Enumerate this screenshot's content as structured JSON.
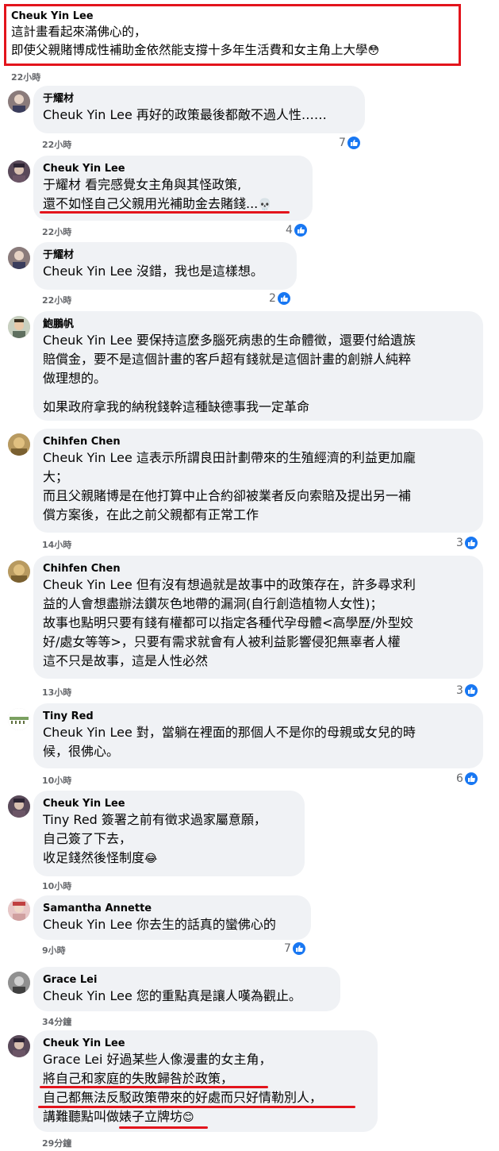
{
  "colors": {
    "highlight_red": "#e3141c",
    "like_blue": "#1877f2",
    "bubble_bg": "#f0f2f5",
    "meta_gray": "#65676b"
  },
  "comments": [
    {
      "author": "Cheuk Yin Lee",
      "lines": [
        "這計畫看起來滿佛心的，",
        "即使父親賭博成性補助金依然能支撐十多年生活費和女主角上大學"
      ],
      "emoji": "😳",
      "time": "22小時"
    },
    {
      "author": "于耀材",
      "mention": "Cheuk Yin Lee",
      "lines": [
        " 再好的政策最後都敵不過人性……"
      ],
      "time": "22小時",
      "likes": "7"
    },
    {
      "author": "Cheuk Yin Lee",
      "mention": "于耀材",
      "lines": [
        " 看完感覺女主角與其怪政策,",
        "還不如怪自己父親用光補助金去賭錢..."
      ],
      "emoji": "💀",
      "time": "22小時",
      "likes": "4"
    },
    {
      "author": "于耀材",
      "mention": "Cheuk Yin Lee",
      "lines": [
        " 沒錯，我也是這樣想。"
      ],
      "time": "22小時",
      "likes": "2"
    },
    {
      "author": "鮑鵬帆",
      "mention": "Cheuk Yin Lee",
      "lines": [
        " 要保持這麼多腦死病患的生命體徵，還要付給遺族",
        "賠償金，要不是這個計畫的客戶超有錢就是這個計畫的創辦人純粹",
        "做理想的。"
      ],
      "paragraph2": "如果政府拿我的納稅錢幹這種缺德事我一定革命"
    },
    {
      "author": "Chihfen Chen",
      "mention": "Cheuk Yin Lee",
      "lines": [
        " 這表示所謂良田計劃帶來的生殖經濟的利益更加龐",
        "大；",
        "而且父親賭博是在他打算中止合約卻被業者反向索賠及提出另一補",
        "償方案後，在此之前父親都有正常工作"
      ],
      "time": "14小時",
      "likes": "3"
    },
    {
      "author": "Chihfen Chen",
      "mention": "Cheuk Yin Lee",
      "lines": [
        " 但有沒有想過就是故事中的政策存在，許多尋求利",
        "益的人會想盡辦法鑽灰色地帶的漏洞(自行創造植物人女性)；",
        "故事也點明只要有錢有權都可以指定各種代孕母體<高學歷/外型姣",
        "好/處女等等>，只要有需求就會有人被利益影響侵犯無辜者人權",
        "這不只是故事，這是人性必然"
      ],
      "time": "13小時",
      "likes": "3"
    },
    {
      "author": "Tiny Red",
      "mention": "Cheuk Yin Lee",
      "lines": [
        " 對，當躺在裡面的那個人不是你的母親或女兒的時",
        "候，很佛心。"
      ],
      "time": "10小時",
      "likes": "6"
    },
    {
      "author": "Cheuk Yin Lee",
      "mention": "Tiny Red",
      "lines": [
        " 簽署之前有徵求過家屬意願，",
        "自己簽了下去，",
        "收足錢然後怪制度"
      ],
      "emoji": "😂",
      "time": "10小時"
    },
    {
      "author": "Samantha Annette",
      "mention": "Cheuk Yin Lee",
      "lines": [
        " 你去生的話真的蠻佛心的"
      ],
      "time": "9小時",
      "likes": "7"
    },
    {
      "author": "Grace Lei",
      "mention": "Cheuk Yin Lee",
      "lines": [
        " 您的重點真是讓人嘆為觀止。"
      ],
      "time": "34分鐘"
    },
    {
      "author": "Cheuk Yin Lee",
      "mention": "Grace Lei",
      "lines": [
        " 好過某些人像漫畫的女主角，",
        "將自己和家庭的失敗歸咎於政策，",
        "自己都無法反駁政策帶來的好處而只好情勒別人，",
        "講難聽點叫做婊子立牌坊"
      ],
      "emoji": "😊",
      "time": "29分鐘"
    }
  ]
}
